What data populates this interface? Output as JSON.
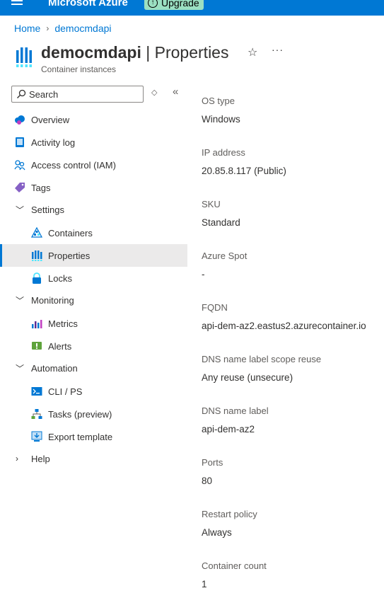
{
  "topbar": {
    "brand": "Microsoft Azure",
    "upgrade_label": "Upgrade",
    "upgrade_icon": "↑"
  },
  "breadcrumb": {
    "home": "Home",
    "current": "democmdapi",
    "separator": "›"
  },
  "header": {
    "resource_name": "democmdapi",
    "pipe": " | ",
    "page": "Properties",
    "subtitle": "Container instances",
    "star": "☆",
    "more": "···"
  },
  "search": {
    "placeholder": "Search",
    "updown": "◇",
    "collapse": "«"
  },
  "nav": {
    "overview": "Overview",
    "activity_log": "Activity log",
    "iam": "Access control (IAM)",
    "tags": "Tags",
    "settings": "Settings",
    "containers": "Containers",
    "properties": "Properties",
    "locks": "Locks",
    "monitoring": "Monitoring",
    "metrics": "Metrics",
    "alerts": "Alerts",
    "automation": "Automation",
    "cli": "CLI / PS",
    "tasks": "Tasks (preview)",
    "export": "Export template",
    "help": "Help"
  },
  "properties": [
    {
      "key": "OS type",
      "value": "Windows"
    },
    {
      "key": "IP address",
      "value": "20.85.8.117 (Public)"
    },
    {
      "key": "SKU",
      "value": "Standard"
    },
    {
      "key": "Azure Spot",
      "value": "-"
    },
    {
      "key": "FQDN",
      "value": "api-dem-az2.eastus2.azurecontainer.io"
    },
    {
      "key": "DNS name label scope reuse",
      "value": "Any reuse (unsecure)"
    },
    {
      "key": "DNS name label",
      "value": "api-dem-az2"
    },
    {
      "key": "Ports",
      "value": "80"
    },
    {
      "key": "Restart policy",
      "value": "Always"
    },
    {
      "key": "Container count",
      "value": "1"
    }
  ],
  "colors": {
    "accent": "#0078d4",
    "selected_bg": "#ebeaea",
    "upgrade_bg": "#9be0c2"
  }
}
